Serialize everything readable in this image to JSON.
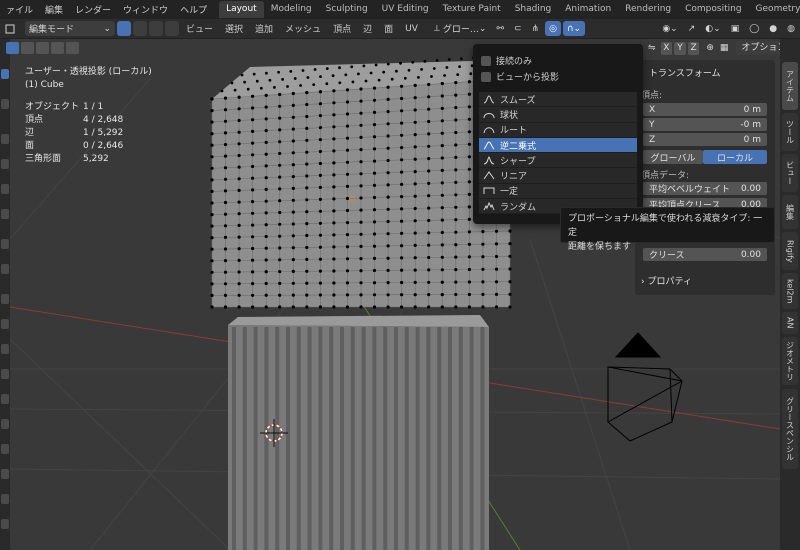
{
  "menubar": {
    "items": [
      "ァイル",
      "編集",
      "レンダー",
      "ウィンドウ",
      "ヘルプ"
    ],
    "tabs": [
      "Layout",
      "Modeling",
      "Sculpting",
      "UV Editing",
      "Texture Paint",
      "Shading",
      "Animation",
      "Rendering",
      "Compositing",
      "Geometry N"
    ],
    "active_tab": "Layout"
  },
  "header": {
    "mode": "編集モード",
    "menus": [
      "ビュー",
      "選択",
      "追加",
      "メッシュ",
      "頂点",
      "辺",
      "面",
      "UV"
    ],
    "transform_orientation": "グロー…"
  },
  "viewport": {
    "view_name": "ユーザー・透視投影 (ローカル)",
    "object_name": "(1) Cube",
    "stats": [
      {
        "label": "オブジェクト",
        "value": "1 / 1"
      },
      {
        "label": "頂点",
        "value": "4 / 2,648"
      },
      {
        "label": "辺",
        "value": "1 / 5,292"
      },
      {
        "label": "面",
        "value": "0 / 2,646"
      },
      {
        "label": "三角形面",
        "value": "5,292"
      }
    ]
  },
  "falloff_popup": {
    "connected_only": "接続のみ",
    "projected": "ビューから投影",
    "items": [
      "スムーズ",
      "球状",
      "ルート",
      "逆二乗式",
      "シャープ",
      "リニア",
      "一定",
      "ランダム"
    ],
    "active_item": "逆二乗式"
  },
  "tooltip": {
    "line1": "プロポーショナル編集で使われる減衰タイプ: 一定",
    "line2": "距離を保ちます"
  },
  "options_row": {
    "axes": [
      "X",
      "Y",
      "Z"
    ],
    "options_label": "オプション"
  },
  "n_panel": {
    "transform_title": "トランスフォーム",
    "vertex_label": "頂点:",
    "fields": [
      {
        "axis": "X",
        "value": "0 m"
      },
      {
        "axis": "Y",
        "value": "-0 m"
      },
      {
        "axis": "Z",
        "value": "0 m"
      }
    ],
    "global_label": "グローバル",
    "local_label": "ローカル",
    "vertex_data_label": "頂点データ:",
    "bevel_weight_label": "平均ベベルウェイト",
    "bevel_weight_value": "0.00",
    "crease_vertex_label": "平均頂点クリース",
    "crease_vertex_value": "0.00",
    "crease_label": "クリース",
    "crease_value": "0.00",
    "properties_label": "プロパティ"
  },
  "right_tabs": [
    "アイテム",
    "ツール",
    "ビュー",
    "編集",
    "Rigify",
    "kel2m",
    "AN",
    "ジオメトリ",
    "グリースペンシル"
  ],
  "colors": {
    "accent": "#4772b3",
    "viewport_bg": "#393939",
    "mesh_face": "#8e8e8e",
    "vertex": "#000000"
  }
}
